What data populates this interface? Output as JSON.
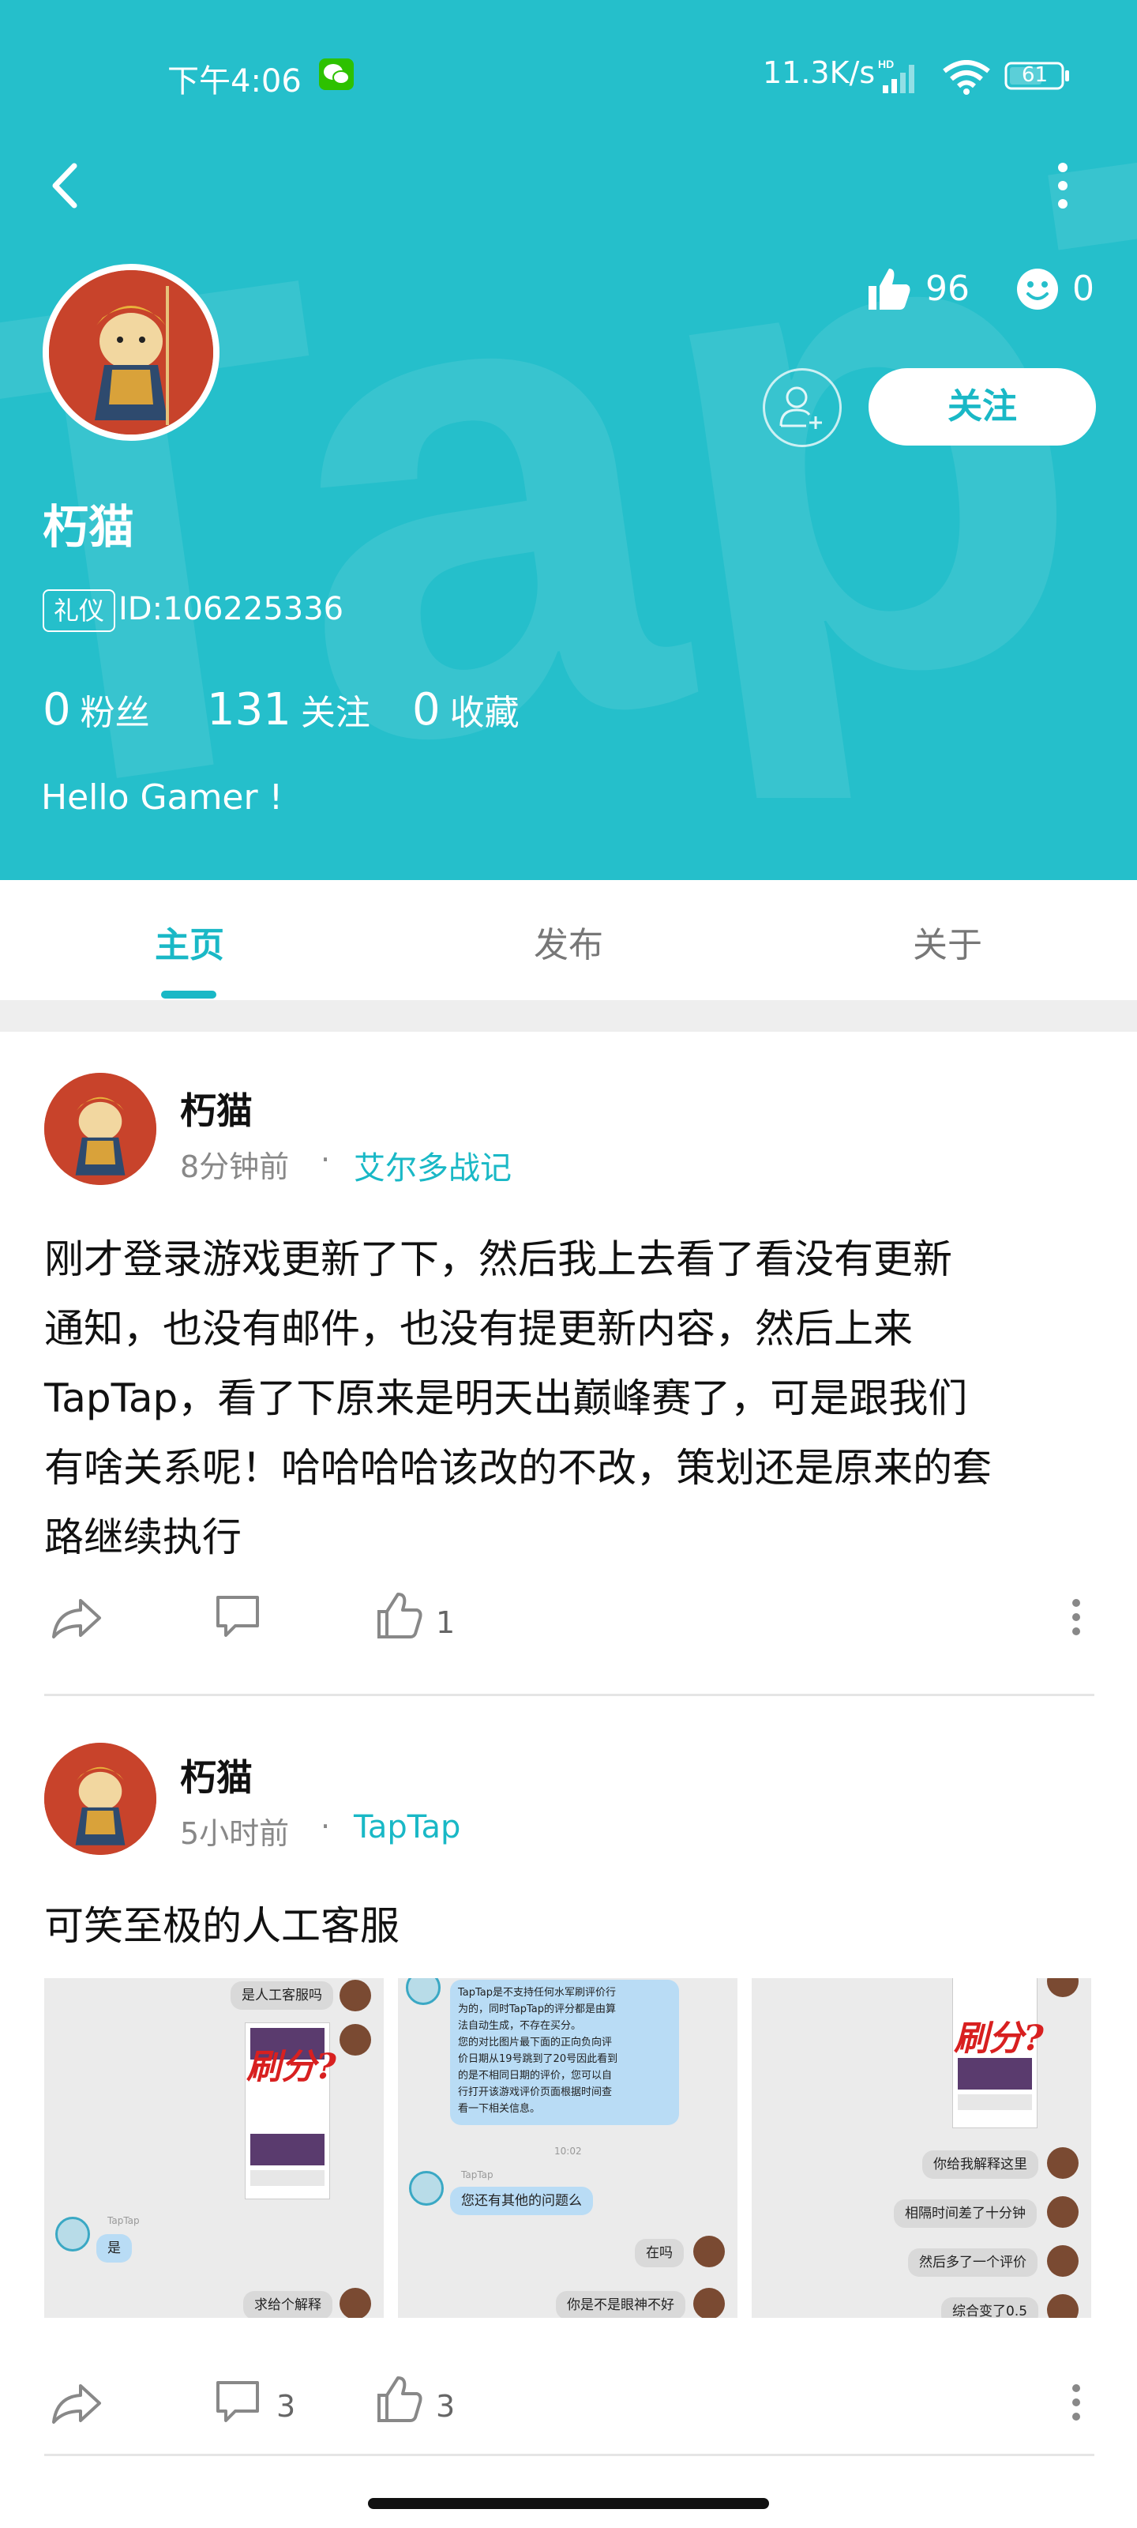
{
  "status_bar": {
    "time": "下午4:06",
    "network_speed": "11.3K/s",
    "battery_level": "61",
    "icons": [
      "wechat-icon",
      "signal-icon",
      "wifi-icon",
      "battery-icon"
    ]
  },
  "profile": {
    "name": "朽猫",
    "badge": "礼仪",
    "id_text": "ID:106225336",
    "likes_count": "96",
    "smile_count": "0",
    "follow_label": "关注",
    "counts": [
      {
        "num": "0",
        "label": "粉丝"
      },
      {
        "num": "131",
        "label": "关注"
      },
      {
        "num": "0",
        "label": "收藏"
      }
    ],
    "bio": "Hello Gamer !"
  },
  "tabs": [
    {
      "label": "主页",
      "active": true
    },
    {
      "label": "发布",
      "active": false
    },
    {
      "label": "关于",
      "active": false
    }
  ],
  "posts": [
    {
      "author": "朽猫",
      "time": "8分钟前",
      "separator": "·",
      "topic": "艾尔多战记",
      "text_lines": [
        "刚才登录游戏更新了下，然后我上去看了看没有更新",
        "通知，也没有邮件，也没有提更新内容，然后上来",
        "TapTap，看了下原来是明天出巅峰赛了，可是跟我们",
        "有啥关系呢！哈哈哈哈该改的不改，策划还是原来的套",
        "路继续执行"
      ],
      "comment_count": "",
      "like_count": "1"
    },
    {
      "author": "朽猫",
      "time": "5小时前",
      "separator": "·",
      "topic": "TapTap",
      "text_lines": [
        "可笑至极的人工客服"
      ],
      "comment_count": "3",
      "like_count": "3",
      "screenshots": {
        "shot1": {
          "msg_top": "是人工客服吗",
          "sticker": "刷分?",
          "sender": "TapTap",
          "reply": "是",
          "msg_bottom": "求给个解释"
        },
        "shot2": {
          "notice": [
            "TapTap是不支持任何水军刷评价行",
            "为的，同时TapTap的评分都是由算",
            "法自动生成，不存在买分。",
            "您的对比图片最下面的正向负向评",
            "价日期从19号跳到了20号因此看到",
            "的是不相同日期的评价，您可以自",
            "行打开该游戏评价页面根据时间查",
            "看一下相关信息。"
          ],
          "timestamp": "10:02",
          "sender": "TapTap",
          "question": "您还有其他的问题么",
          "reply1": "在吗",
          "reply2": "你是不是眼神不好"
        },
        "shot3": {
          "sticker": "刷分?",
          "msg1": "你给我解释这里",
          "msg2": "相隔时间差了十分钟",
          "msg3": "然后多了一个评价",
          "msg4": "综合变了0.5"
        }
      }
    }
  ]
}
